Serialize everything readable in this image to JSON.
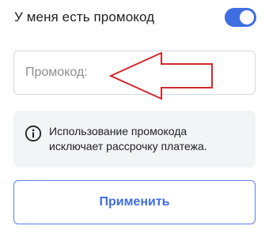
{
  "promo_toggle": {
    "label": "У меня есть промокод",
    "on": true,
    "color": "#3f6de2"
  },
  "promo_input": {
    "placeholder": "Промокод:",
    "value": ""
  },
  "annotation": {
    "icon": "arrow-left-icon",
    "color": "#d0282e"
  },
  "info": {
    "icon": "info-icon",
    "line1": "Использование промокода",
    "line2": "исключает рассрочку платежа."
  },
  "apply_button": {
    "label": "Применить"
  }
}
